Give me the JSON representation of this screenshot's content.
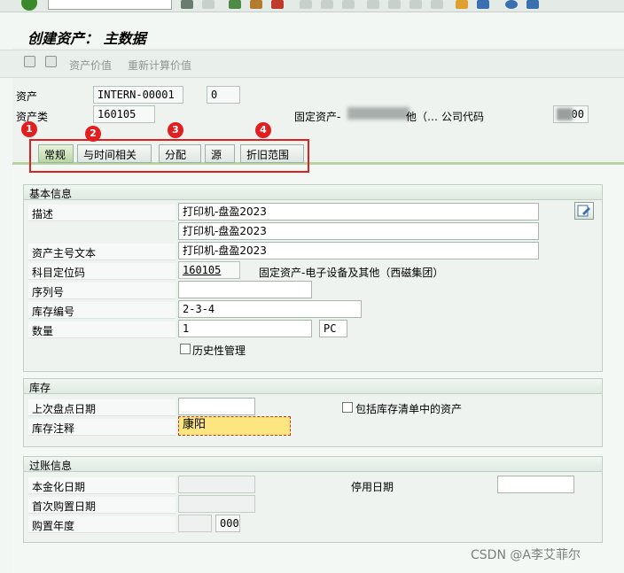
{
  "window": {
    "title": "创建资产： 主数据"
  },
  "app_toolbar": {
    "asset_value": "资产价值",
    "recalc_value": "重新计算价值"
  },
  "header": {
    "asset_label": "资产",
    "asset_number": "INTERN-00001",
    "asset_sub": "0",
    "class_label": "资产类",
    "class_value": "160105",
    "class_desc": "固定资产-",
    "class_desc_tail": "他（…",
    "company_label": "公司代码",
    "company_value": "00"
  },
  "tabs": [
    {
      "label": "常规",
      "active": true
    },
    {
      "label": "与时间相关",
      "active": false
    },
    {
      "label": "分配",
      "active": false
    },
    {
      "label": "源",
      "active": false
    },
    {
      "label": "折旧范围",
      "active": false
    }
  ],
  "annotations": {
    "badge1": "1",
    "badge2": "2",
    "badge3": "3",
    "badge4": "4",
    "color": "#e02020"
  },
  "general": {
    "title": "基本信息",
    "desc_label": "描述",
    "desc1": "打印机-盘盈2023",
    "desc2": "打印机-盘盈2023",
    "main_text_label": "资产主号文本",
    "main_text": "打印机-盘盈2023",
    "acct_label": "科目定位码",
    "acct_value": "160105",
    "acct_desc": "固定资产-电子设备及其他（西磁集团）",
    "serial_label": "序列号",
    "serial_value": "",
    "inventory_label": "库存编号",
    "inventory_value": "2-3-4",
    "qty_label": "数量",
    "qty_value": "1",
    "qty_unit": "PC",
    "history_label": "历史性管理"
  },
  "inventory": {
    "title": "库存",
    "last_date_label": "上次盘点日期",
    "last_date_value": "",
    "include_label": "包括库存清单中的资产",
    "note_label": "库存注释",
    "note_value": "康阳"
  },
  "posting": {
    "title": "过账信息",
    "cap_date_label": "本金化日期",
    "cap_date_value": "",
    "deact_label": "停用日期",
    "deact_value": "",
    "first_acq_label": "首次购置日期",
    "first_acq_value": "",
    "acq_year_label": "购置年度",
    "acq_year_value": "",
    "acq_period": "000"
  },
  "watermark": "CSDN @A李艾菲尔",
  "colors": {
    "accent_green": "#b5d3a5",
    "focus_yellow": "#fde680",
    "annotation_red": "#e02020"
  }
}
